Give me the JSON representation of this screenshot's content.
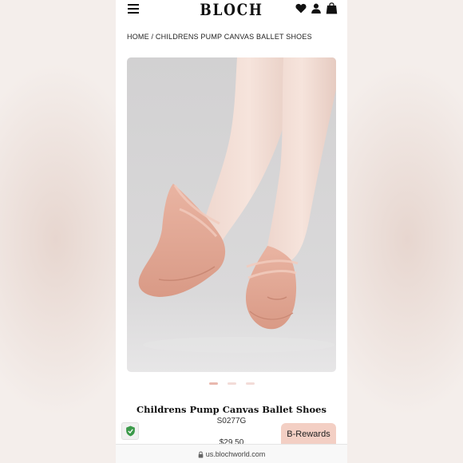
{
  "header": {
    "logo": "BLOCH",
    "icons": [
      "menu-icon",
      "heart-icon",
      "user-icon",
      "bag-icon"
    ]
  },
  "breadcrumb": {
    "home": "HOME",
    "separator": "/",
    "current": "CHILDRENS PUMP CANVAS BALLET SHOES"
  },
  "product": {
    "image_alt": "Pink canvas ballet shoes",
    "carousel": {
      "count": 3,
      "active": 1
    },
    "title": "Childrens Pump Canvas Ballet Shoes",
    "sku": "S0277G",
    "price": "$29.50"
  },
  "rewards": {
    "label": "B-Rewards"
  },
  "security_badge": {
    "icon": "shield-check-icon"
  },
  "browser": {
    "url": "us.blochworld.com",
    "icon": "lock-icon"
  },
  "colors": {
    "accent": "#f3cfc4",
    "dot_active": "#e9b8ae",
    "dot_inactive": "#f3dcd8",
    "shield": "#3b9a4a"
  }
}
